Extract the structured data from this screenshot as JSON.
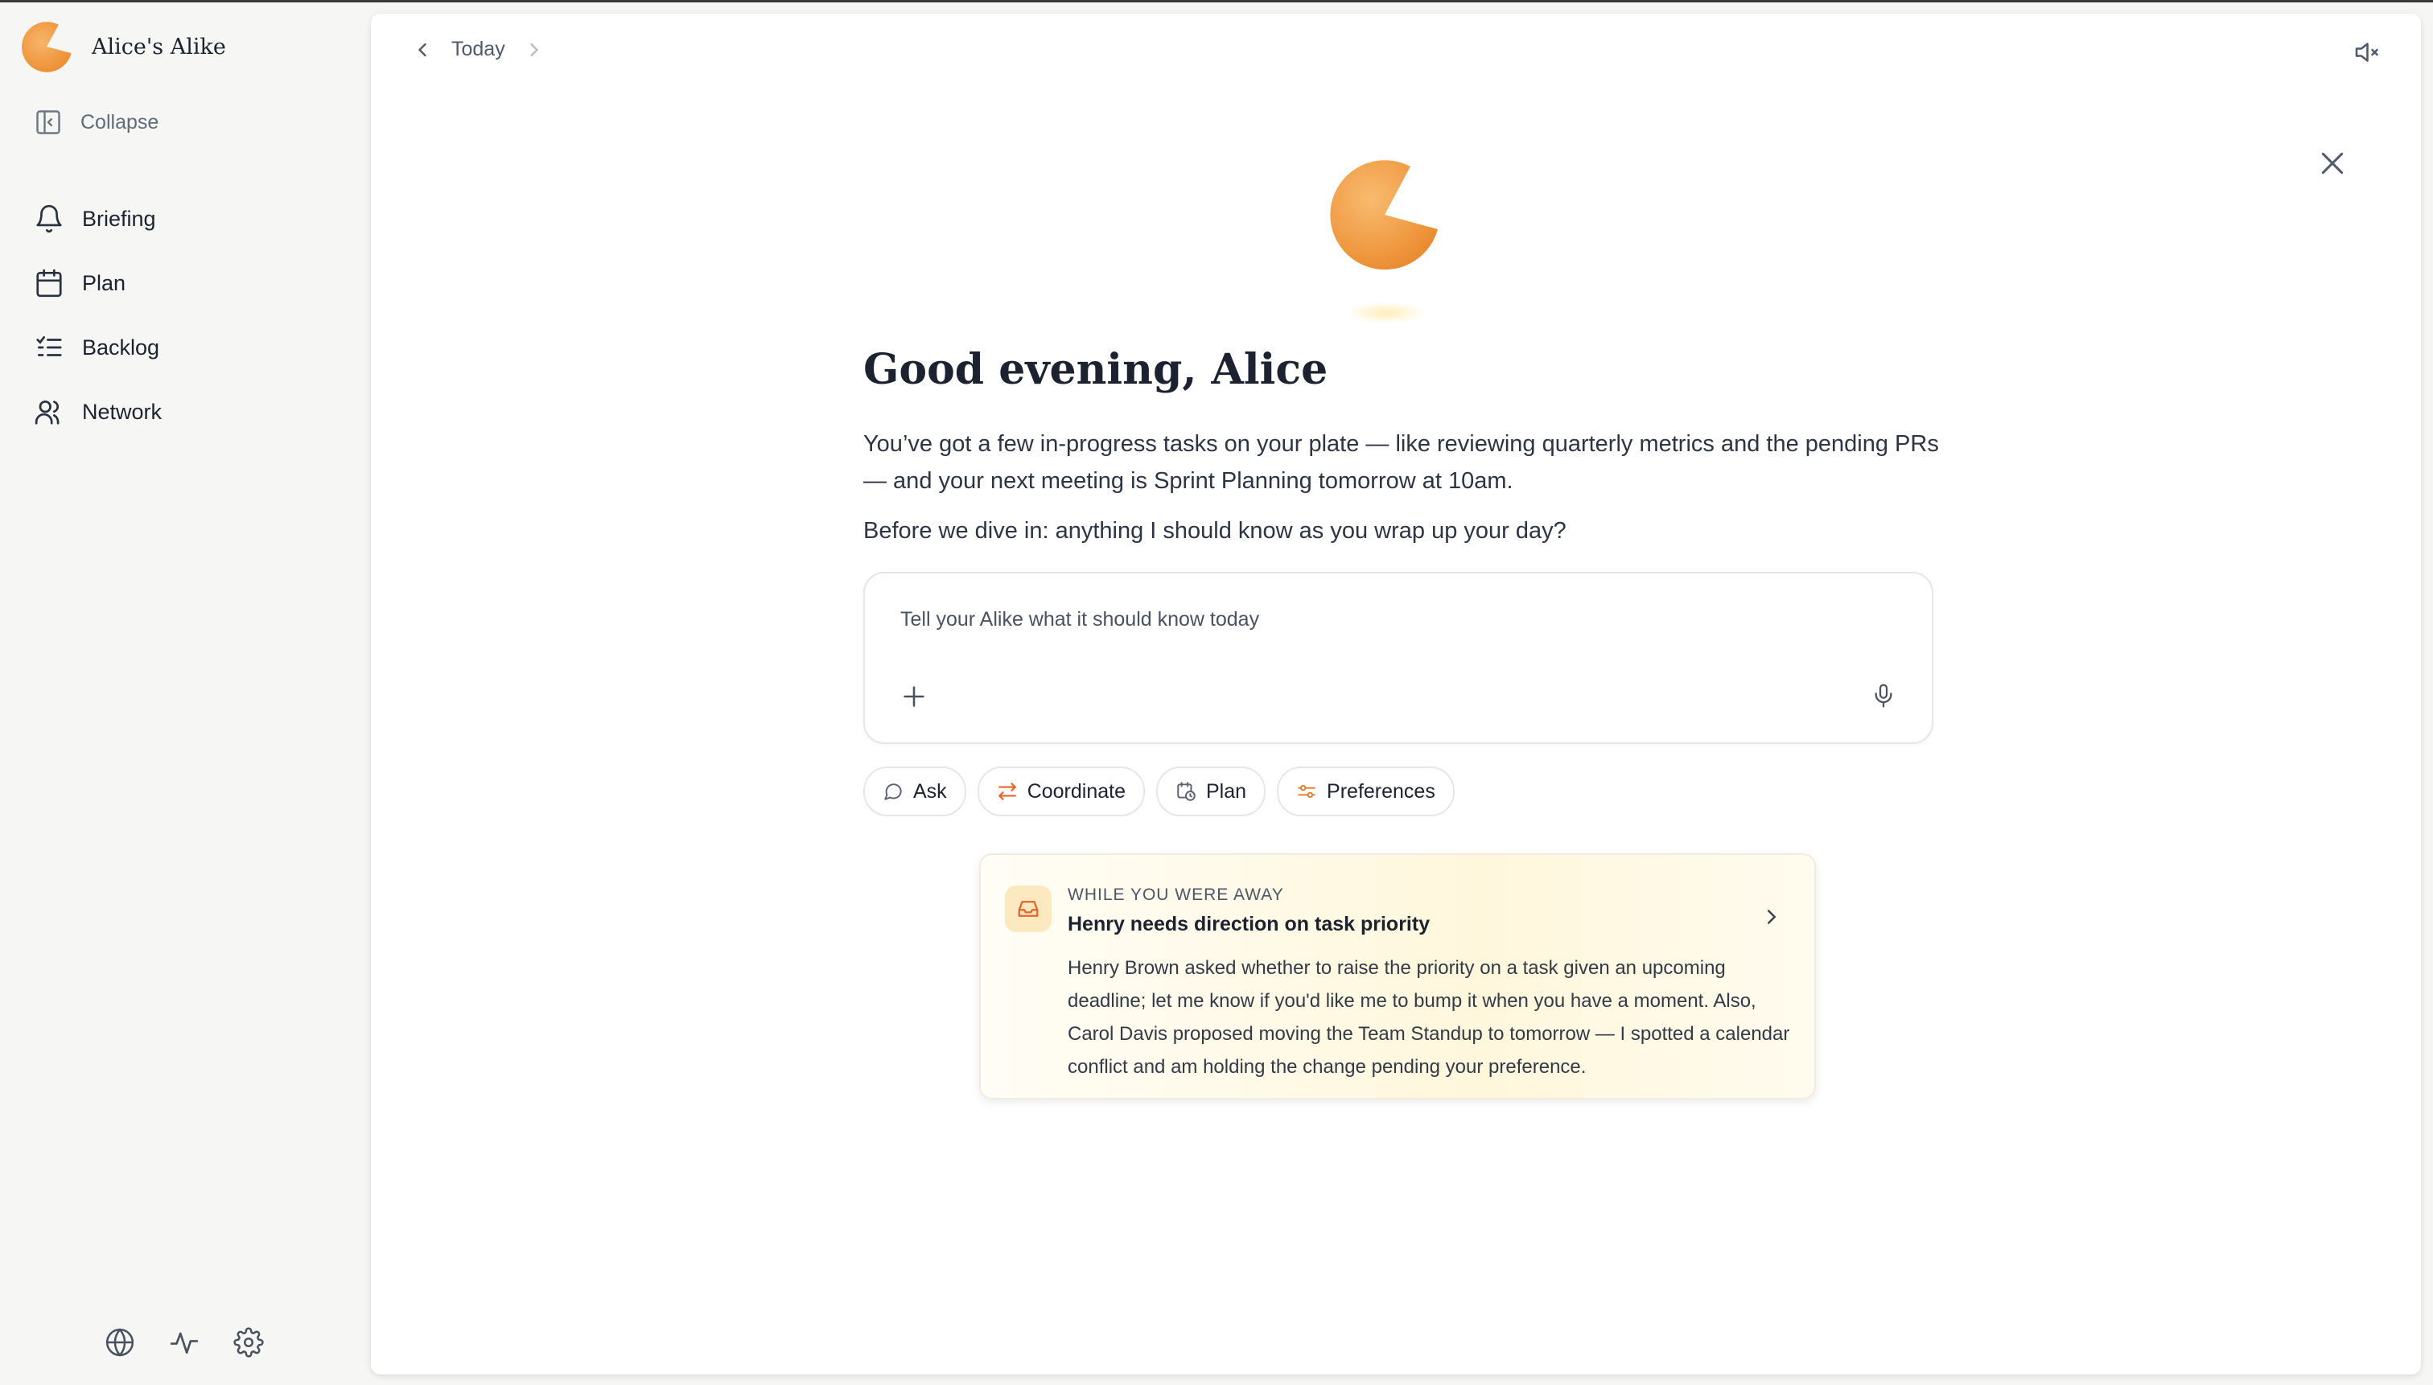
{
  "sidebar": {
    "brand_name": "Alice's Alike",
    "collapse_label": "Collapse",
    "items": [
      {
        "label": "Briefing",
        "icon": "bell-icon"
      },
      {
        "label": "Plan",
        "icon": "calendar-icon"
      },
      {
        "label": "Backlog",
        "icon": "checklist-icon"
      },
      {
        "label": "Network",
        "icon": "users-icon"
      }
    ],
    "footer_icons": [
      "globe-icon",
      "activity-icon",
      "settings-icon"
    ]
  },
  "topbar": {
    "date_label": "Today"
  },
  "main": {
    "greeting": "Good evening, Alice",
    "summary": "You’ve got a few in-progress tasks on your plate — like reviewing quarterly metrics and the pending PRs — and your next meeting is Sprint Planning tomorrow at 10am.",
    "prompt": "Before we dive in: anything I should know as you wrap up your day?",
    "composer_placeholder": "Tell your Alike what it should know today",
    "chips": [
      {
        "label": "Ask",
        "icon": "chat-bubble-icon"
      },
      {
        "label": "Coordinate",
        "icon": "arrows-swap-icon"
      },
      {
        "label": "Plan",
        "icon": "calendar-clock-icon"
      },
      {
        "label": "Preferences",
        "icon": "sliders-icon"
      }
    ]
  },
  "away_card": {
    "kicker": "WHILE YOU WERE AWAY",
    "title": "Henry needs direction on task priority",
    "body": "Henry Brown asked whether to raise the priority on a task given an upcoming deadline; let me know if you'd like me to bump it when you have a moment. Also, Carol Davis proposed moving the Team Standup to tomorrow — I spotted a calendar conflict and am holding the change pending your preference."
  },
  "colors": {
    "accent_orange": "#f29a43",
    "card_bg": "#fff7dc",
    "card_icon_bg": "#fde9c0"
  }
}
